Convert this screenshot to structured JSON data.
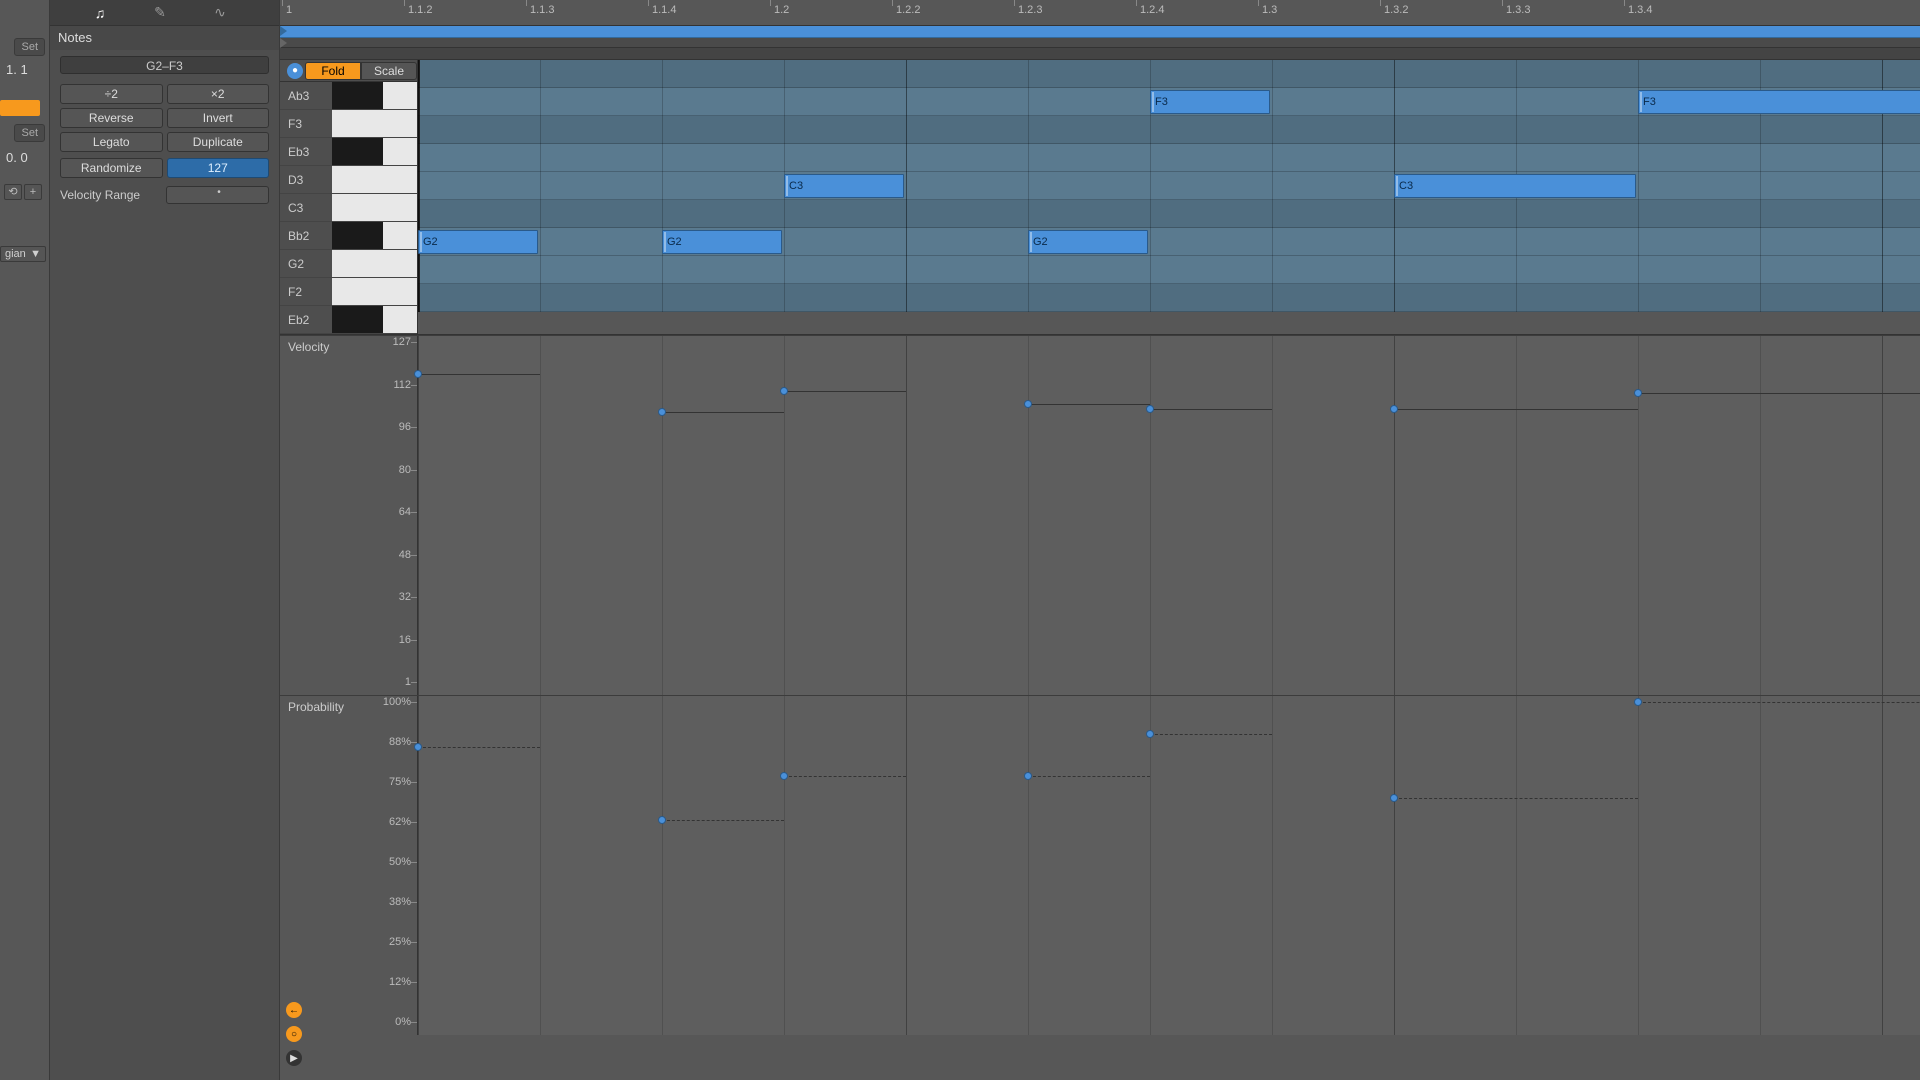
{
  "left_panel": {
    "set1_label": "Set",
    "val1": "1.  1",
    "set2_label": "Set",
    "val2": "0.  0",
    "plus_icon": "+",
    "dot_icon": "⟲",
    "scale_name": "gian",
    "dd_arrow": "▼"
  },
  "notes_panel": {
    "tab_note_icon": "♫",
    "tab_env_icon": "✎",
    "tab_exp_icon": "∿",
    "header": "Notes",
    "range": "G2–F3",
    "buttons": {
      "half": "÷2",
      "double": "×2",
      "reverse": "Reverse",
      "invert": "Invert",
      "legato": "Legato",
      "duplicate": "Duplicate",
      "randomize": "Randomize"
    },
    "randomize_value": "127",
    "velocity_range_label": "Velocity Range"
  },
  "editor_header": {
    "fold": "Fold",
    "scale": "Scale"
  },
  "timeline": {
    "ticks": [
      "1",
      "1.1.2",
      "1.1.3",
      "1.1.4",
      "1.2",
      "1.2.2",
      "1.2.3",
      "1.2.4",
      "1.3",
      "1.3.2",
      "1.3.3",
      "1.3.4"
    ]
  },
  "piano": {
    "keys": [
      {
        "label": "Ab3",
        "black": true
      },
      {
        "label": "F3",
        "black": false
      },
      {
        "label": "Eb3",
        "black": true
      },
      {
        "label": "D3",
        "black": false
      },
      {
        "label": "C3",
        "black": false
      },
      {
        "label": "Bb2",
        "black": true
      },
      {
        "label": "G2",
        "black": false
      },
      {
        "label": "F2",
        "black": false
      },
      {
        "label": "Eb2",
        "black": true
      }
    ],
    "notes": [
      {
        "pitch": "G2",
        "start": 0,
        "len": 1,
        "label": "G2"
      },
      {
        "pitch": "G2",
        "start": 2,
        "len": 1,
        "label": "G2"
      },
      {
        "pitch": "C3",
        "start": 3,
        "len": 1,
        "label": "C3"
      },
      {
        "pitch": "G2",
        "start": 5,
        "len": 1,
        "label": "G2"
      },
      {
        "pitch": "F3",
        "start": 6,
        "len": 1,
        "label": "F3"
      },
      {
        "pitch": "C3",
        "start": 8,
        "len": 2,
        "label": "C3"
      },
      {
        "pitch": "F3",
        "start": 10,
        "len": 3,
        "label": "F3"
      }
    ]
  },
  "velocity_lane": {
    "title": "Velocity",
    "axis": [
      "127",
      "112",
      "96",
      "80",
      "64",
      "48",
      "32",
      "16",
      "1"
    ],
    "points": [
      {
        "start": 0,
        "len": 1,
        "val": 115
      },
      {
        "start": 2,
        "len": 1,
        "val": 101
      },
      {
        "start": 3,
        "len": 1,
        "val": 109
      },
      {
        "start": 5,
        "len": 1,
        "val": 104
      },
      {
        "start": 6,
        "len": 1,
        "val": 102
      },
      {
        "start": 8,
        "len": 2,
        "val": 102
      },
      {
        "start": 10,
        "len": 3,
        "val": 108
      }
    ]
  },
  "probability_lane": {
    "title": "Probability",
    "axis": [
      "100%",
      "88%",
      "75%",
      "62%",
      "50%",
      "38%",
      "25%",
      "12%",
      "0%"
    ],
    "points": [
      {
        "start": 0,
        "len": 1,
        "val": 86
      },
      {
        "start": 2,
        "len": 1,
        "val": 63
      },
      {
        "start": 3,
        "len": 1,
        "val": 77
      },
      {
        "start": 5,
        "len": 1,
        "val": 77
      },
      {
        "start": 6,
        "len": 1,
        "val": 90
      },
      {
        "start": 8,
        "len": 2,
        "val": 70
      },
      {
        "start": 10,
        "len": 3,
        "val": 100
      }
    ]
  },
  "bottom_icons": {
    "left_arrow": "←",
    "circle2": "○",
    "play": "▶"
  },
  "chart_data": [
    {
      "type": "scatter",
      "title": "Velocity",
      "ylabel": "Velocity",
      "ylim": [
        1,
        127
      ],
      "x": [
        0,
        2,
        3,
        5,
        6,
        8,
        10
      ],
      "values": [
        115,
        101,
        109,
        104,
        102,
        102,
        108
      ]
    },
    {
      "type": "scatter",
      "title": "Probability",
      "ylabel": "Probability (%)",
      "ylim": [
        0,
        100
      ],
      "x": [
        0,
        2,
        3,
        5,
        6,
        8,
        10
      ],
      "values": [
        86,
        63,
        77,
        77,
        90,
        70,
        100
      ]
    }
  ]
}
